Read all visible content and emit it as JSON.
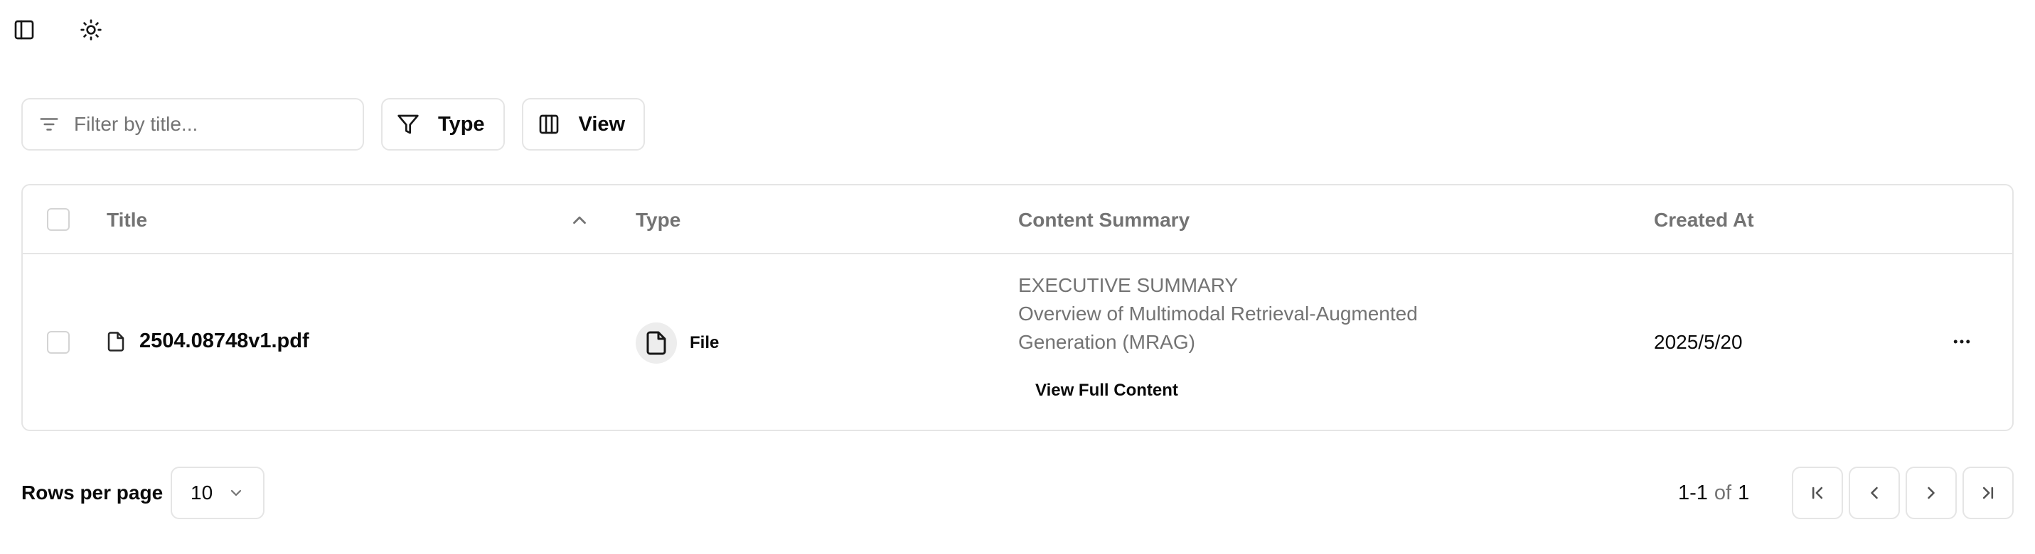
{
  "topbar": {
    "icons": [
      "sidebar-toggle-icon",
      "sun-icon"
    ]
  },
  "toolbar": {
    "filter_placeholder": "Filter by title...",
    "filter_value": "",
    "type_button_label": "Type",
    "view_button_label": "View"
  },
  "table": {
    "columns": {
      "title": "Title",
      "type": "Type",
      "summary": "Content Summary",
      "created": "Created At"
    },
    "rows": [
      {
        "title": "2504.08748v1.pdf",
        "type": "File",
        "summary_line1": "EXECUTIVE SUMMARY",
        "summary_line2": "Overview of Multimodal Retrieval-Augmented Generation (MRAG)",
        "view_full_label": "View Full Content",
        "created_at": "2025/5/20"
      }
    ]
  },
  "pagination": {
    "rows_per_page_label": "Rows per page",
    "rows_per_page_value": "10",
    "range": "1-1",
    "of_label": "of",
    "total": "1"
  },
  "colors": {
    "border": "#e5e5e5",
    "muted_text": "#737373",
    "text": "#0a0a0a"
  }
}
